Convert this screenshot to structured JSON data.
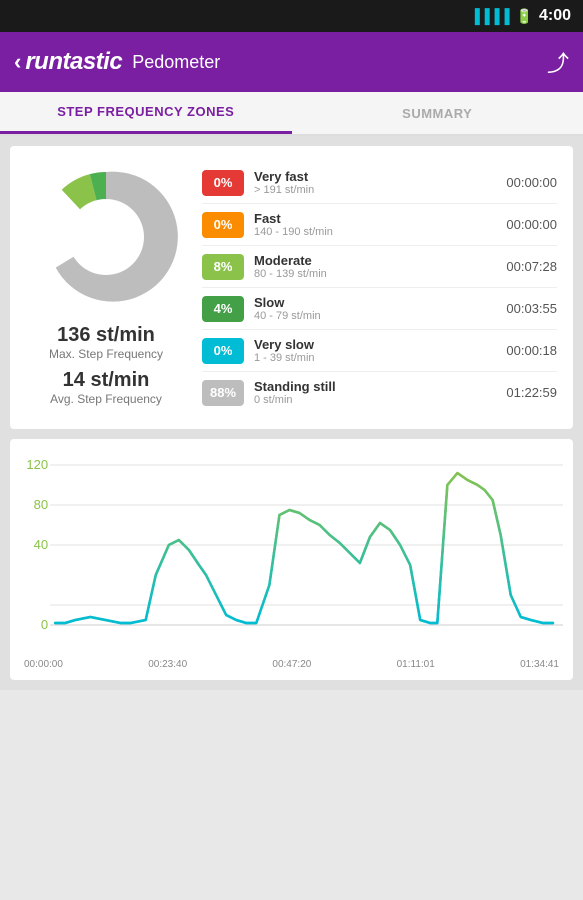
{
  "statusBar": {
    "time": "4:00"
  },
  "toolbar": {
    "backLabel": "‹",
    "logoRuntastic": "runtastic",
    "logoPedometer": "Pedometer",
    "shareIcon": "⤴"
  },
  "tabs": [
    {
      "id": "step-freq",
      "label": "STEP FREQUENCY ZONES",
      "active": true
    },
    {
      "id": "summary",
      "label": "SUMMARY",
      "active": false
    }
  ],
  "zoneCard": {
    "pieChart": {
      "segments": [
        {
          "color": "#d32f2f",
          "percent": 0
        },
        {
          "color": "#f57c00",
          "percent": 0
        },
        {
          "color": "#8bc34a",
          "percent": 8
        },
        {
          "color": "#4caf50",
          "percent": 4
        },
        {
          "color": "#00bcd4",
          "percent": 0
        },
        {
          "color": "#bdbdbd",
          "percent": 88
        }
      ]
    },
    "maxFreq": "136 st/min",
    "maxLabel": "Max. Step Frequency",
    "avgFreq": "14 st/min",
    "avgLabel": "Avg. Step Frequency",
    "zones": [
      {
        "name": "Very fast",
        "range": "> 191 st/min",
        "percent": "0%",
        "time": "00:00:00",
        "color": "#e53935"
      },
      {
        "name": "Fast",
        "range": "140 - 190 st/min",
        "percent": "0%",
        "time": "00:00:00",
        "color": "#fb8c00"
      },
      {
        "name": "Moderate",
        "range": "80 - 139 st/min",
        "percent": "8%",
        "time": "00:07:28",
        "color": "#8bc34a"
      },
      {
        "name": "Slow",
        "range": "40 - 79 st/min",
        "percent": "4%",
        "time": "00:03:55",
        "color": "#43a047"
      },
      {
        "name": "Very slow",
        "range": "1 - 39 st/min",
        "percent": "0%",
        "time": "00:00:18",
        "color": "#00bcd4"
      },
      {
        "name": "Standing still",
        "range": "0 st/min",
        "percent": "88%",
        "time": "01:22:59",
        "color": "#bdbdbd"
      }
    ]
  },
  "chart": {
    "yLabels": [
      "120",
      "80",
      "40",
      "0"
    ],
    "xLabels": [
      "00:00:00",
      "00:23:40",
      "00:47:20",
      "01:11:01",
      "01:34:41"
    ],
    "gridLines": [
      120,
      80,
      40,
      0
    ],
    "maxY": 130
  }
}
